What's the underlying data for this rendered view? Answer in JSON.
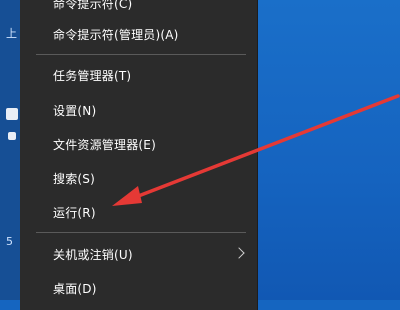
{
  "left_strip": {
    "glyphs": [
      "上",
      "5"
    ]
  },
  "menu": {
    "items": [
      {
        "label": "命令提示符(C)"
      },
      {
        "label": "命令提示符(管理员)(A)"
      },
      {
        "label": "任务管理器(T)"
      },
      {
        "label": "设置(N)"
      },
      {
        "label": "文件资源管理器(E)"
      },
      {
        "label": "搜索(S)"
      },
      {
        "label": "运行(R)"
      },
      {
        "label": "关机或注销(U)"
      },
      {
        "label": "桌面(D)"
      }
    ]
  },
  "colors": {
    "menu_bg": "#2b2b2b",
    "desktop_bg": "#1565c0",
    "arrow": "#e53935"
  }
}
